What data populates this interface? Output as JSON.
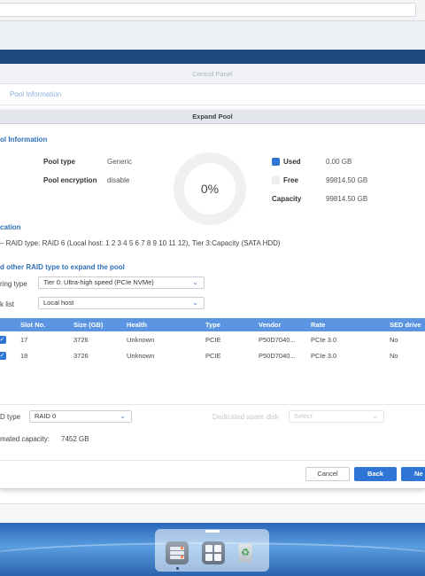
{
  "control_panel": {
    "title": "Control Panel",
    "tab": "Pool Information"
  },
  "dialog": {
    "title": "Expand Pool",
    "pool_info": {
      "section_title": "ol Information",
      "pool_type_label": "Pool type",
      "pool_type_value": "Generic",
      "encryption_label": "Pool encryption",
      "encryption_value": "disable",
      "usage_percent_text": "0%",
      "usage_fraction": 0,
      "used_label": "Used",
      "used_value": "0.00 GB",
      "free_label": "Free",
      "free_value": "99814.50 GB",
      "capacity_label": "Capacity",
      "capacity_value": "99814.50 GB",
      "used_color": "#2f75d6",
      "free_color": "#eeeeee"
    },
    "allocation": {
      "section_title": "cation",
      "detail": "– RAID type: RAID 6 (Local host: 1 2 3 4 5 6 7 8 9 10 11 12), Tier 3:Capacity (SATA HDD)"
    },
    "expand": {
      "section_title": "d other RAID type to expand the pool",
      "tiering_label": "ring type",
      "tiering_value": "Tier 0: Ultra-high speed (PCIe NVMe)",
      "disk_list_label": "k list",
      "disk_list_value": "Local host"
    },
    "table": {
      "headers": [
        "Slot No.",
        "Size (GB)",
        "Health",
        "Type",
        "Vendor",
        "Rate",
        "SED drive"
      ],
      "rows": [
        {
          "checked": true,
          "slot": "17",
          "size": "3726",
          "health": "Unknown",
          "type": "PCIE",
          "vendor": "P50D7040...",
          "rate": "PCIe 3.0",
          "sed": "No"
        },
        {
          "checked": true,
          "slot": "18",
          "size": "3726",
          "health": "Unknown",
          "type": "PCIE",
          "vendor": "P50D7040...",
          "rate": "PCIe 3.0",
          "sed": "No"
        }
      ]
    },
    "raid": {
      "label": "D type",
      "value": "RAID 0",
      "spare_label": "Dedicated spare disk",
      "spare_placeholder": "Select",
      "est_label": "mated capacity:",
      "est_value": "7452 GB"
    },
    "buttons": {
      "cancel": "Cancel",
      "back": "Back",
      "next": "Ne"
    }
  },
  "dock": {
    "items": [
      "storage-manager-icon",
      "app-center-icon",
      "recycle-bin-icon"
    ]
  },
  "colors": {
    "accent": "#2f75d6",
    "header_blue": "#5b95e2",
    "title_bar": "#1e4a7e",
    "section_title": "#2e6fb8"
  }
}
